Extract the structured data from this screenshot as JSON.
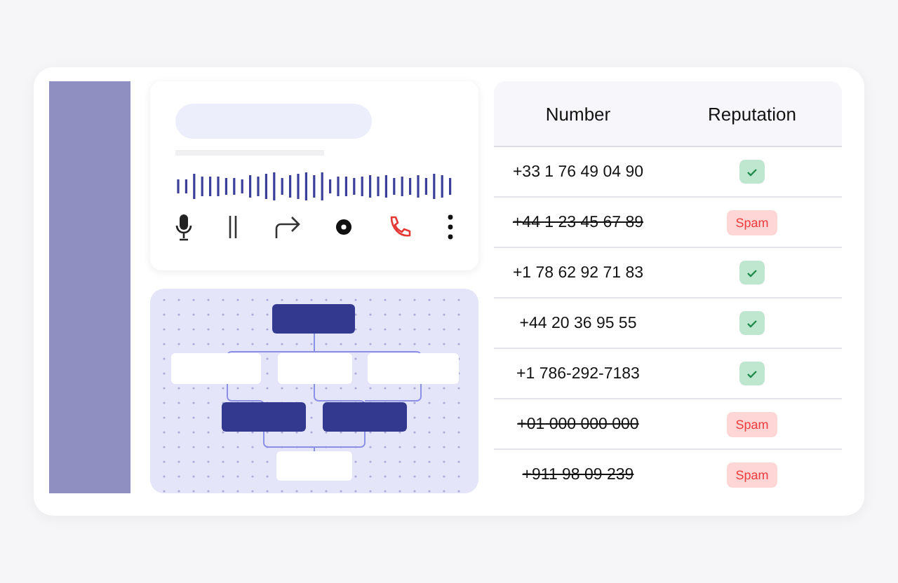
{
  "table": {
    "columns": [
      "Number",
      "Reputation"
    ],
    "rows": [
      {
        "number": "+33 1 76 49 04 90",
        "struck": false,
        "reputation": {
          "kind": "verified"
        }
      },
      {
        "number": "+44 1 23 45 67 89",
        "struck": true,
        "reputation": {
          "kind": "spam",
          "label": "Spam"
        }
      },
      {
        "number": "+1 78 62 92 71 83",
        "struck": false,
        "reputation": {
          "kind": "verified"
        }
      },
      {
        "number": "+44 20 36 95 55",
        "struck": false,
        "reputation": {
          "kind": "verified"
        }
      },
      {
        "number": "+1 786-292-7183",
        "struck": false,
        "reputation": {
          "kind": "verified"
        }
      },
      {
        "number": "+01 000 000 000",
        "struck": true,
        "reputation": {
          "kind": "spam",
          "label": "Spam"
        }
      },
      {
        "number": "+911 98 09 239",
        "struck": true,
        "reputation": {
          "kind": "spam",
          "label": "Spam"
        }
      }
    ]
  }
}
